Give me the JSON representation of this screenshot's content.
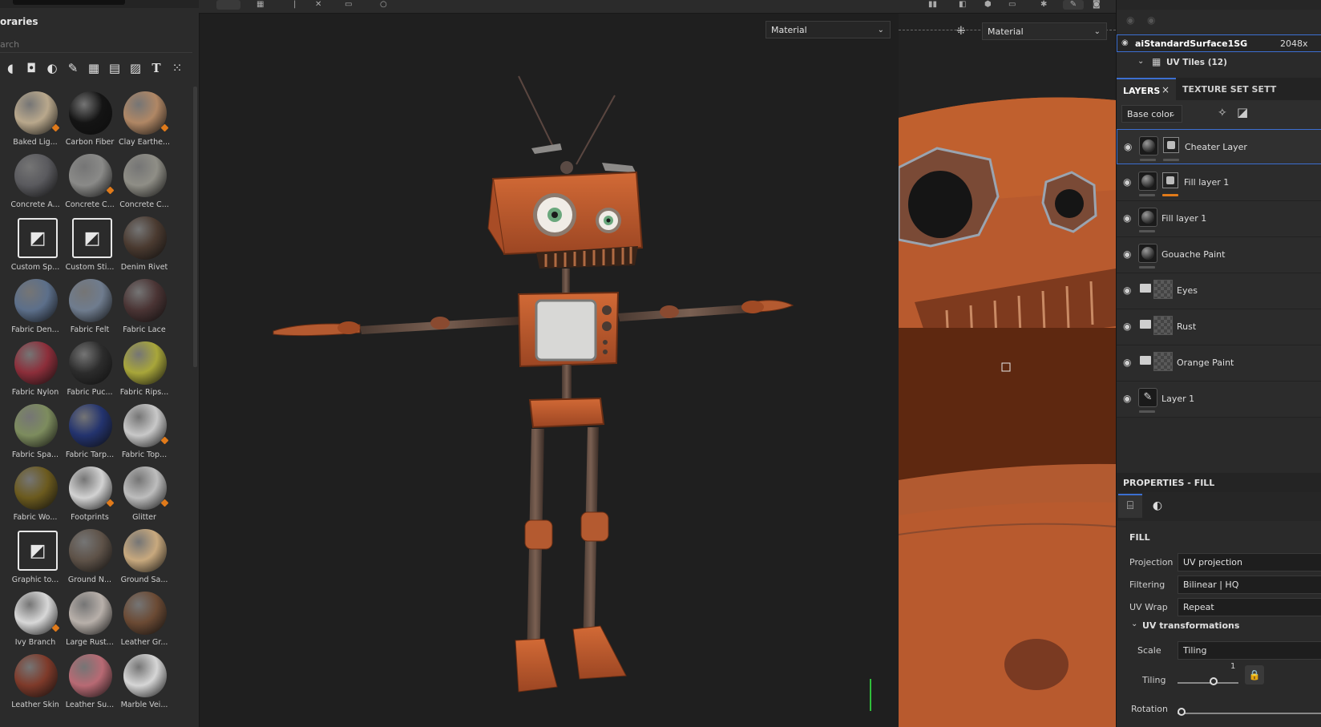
{
  "shelf": {
    "title": "oraries",
    "search_placeholder": "arch",
    "filter_icons": [
      "shape-icon",
      "square-icon",
      "material-icon",
      "brush-icon",
      "pattern-icon",
      "grid-icon",
      "image-icon",
      "text-icon",
      "apps-icon"
    ],
    "items": [
      {
        "label": "Baked Lig...",
        "color": "#b9a88c"
      },
      {
        "label": "Carbon Fiber",
        "color": "#141414"
      },
      {
        "label": "Clay Earthe...",
        "color": "#b08765"
      },
      {
        "label": "Concrete A...",
        "color": "#5a5a5e"
      },
      {
        "label": "Concrete C...",
        "color": "#8a8a88"
      },
      {
        "label": "Concrete C...",
        "color": "#8f8e86"
      },
      {
        "label": "Custom Sp...",
        "color": "square"
      },
      {
        "label": "Custom Sti...",
        "color": "square"
      },
      {
        "label": "Denim Rivet",
        "color": "#4a3a30"
      },
      {
        "label": "Fabric Den...",
        "color": "#5c6f8a"
      },
      {
        "label": "Fabric Felt",
        "color": "#6f7c8e"
      },
      {
        "label": "Fabric Lace",
        "color": "#4a3434"
      },
      {
        "label": "Fabric Nylon",
        "color": "#8c2e3a"
      },
      {
        "label": "Fabric Puc...",
        "color": "#2c2c2c"
      },
      {
        "label": "Fabric Rips...",
        "color": "#a8a63a"
      },
      {
        "label": "Fabric Spa...",
        "color": "#7d8c5e"
      },
      {
        "label": "Fabric Tarp...",
        "color": "#23336e"
      },
      {
        "label": "Fabric Top...",
        "color": "#c8c8c8"
      },
      {
        "label": "Fabric Wo...",
        "color": "#6b5a1e"
      },
      {
        "label": "Footprints",
        "color": "#d2d2d2"
      },
      {
        "label": "Glitter",
        "color": "#bdbdbd"
      },
      {
        "label": "Graphic to...",
        "color": "square"
      },
      {
        "label": "Ground N...",
        "color": "#5e5248"
      },
      {
        "label": "Ground Sa...",
        "color": "#c8a97e"
      },
      {
        "label": "Ivy Branch",
        "color": "#d8d8d8"
      },
      {
        "label": "Large Rust...",
        "color": "#b8b0aa"
      },
      {
        "label": "Leather Gr...",
        "color": "#6b4a34"
      },
      {
        "label": "Leather Skin",
        "color": "#7e3a2a"
      },
      {
        "label": "Leather Su...",
        "color": "#b86a74"
      },
      {
        "label": "Marble Vei...",
        "color": "#d6d6d6"
      }
    ]
  },
  "viewport3d": {
    "mode_select": "Material"
  },
  "viewport2d": {
    "mode_select": "Material"
  },
  "texture_set": {
    "name": "aiStandardSurface1SG",
    "resolution": "2048x",
    "uv_tiles": "UV Tiles (12)"
  },
  "tabs": {
    "layers": "LAYERS",
    "texture_set_settings": "TEXTURE SET SETT"
  },
  "layers": {
    "channel": "Base color",
    "items": [
      {
        "name": "Cheater Layer",
        "kind": "fill-mask"
      },
      {
        "name": "Fill layer 1",
        "kind": "fill-mask"
      },
      {
        "name": "Fill layer 1",
        "kind": "fill"
      },
      {
        "name": "Gouache Paint",
        "kind": "fill"
      },
      {
        "name": "Eyes",
        "kind": "folder"
      },
      {
        "name": "Rust",
        "kind": "folder"
      },
      {
        "name": "Orange Paint",
        "kind": "folder"
      },
      {
        "name": "Layer 1",
        "kind": "paint"
      }
    ]
  },
  "properties": {
    "title": "PROPERTIES - FILL",
    "section": "FILL",
    "rows": [
      {
        "label": "Projection",
        "value": "UV projection"
      },
      {
        "label": "Filtering",
        "value": "Bilinear | HQ"
      },
      {
        "label": "UV Wrap",
        "value": "Repeat"
      }
    ],
    "uv_transform_title": "UV transformations",
    "scale_label": "Scale",
    "scale_value": "Tiling",
    "tiling_label": "Tiling",
    "tiling_value": "1",
    "rotation_label": "Rotation"
  },
  "colors": {
    "accent": "#3c6fd1",
    "orange": "#e07a1a",
    "robot": "#c25a2c"
  }
}
